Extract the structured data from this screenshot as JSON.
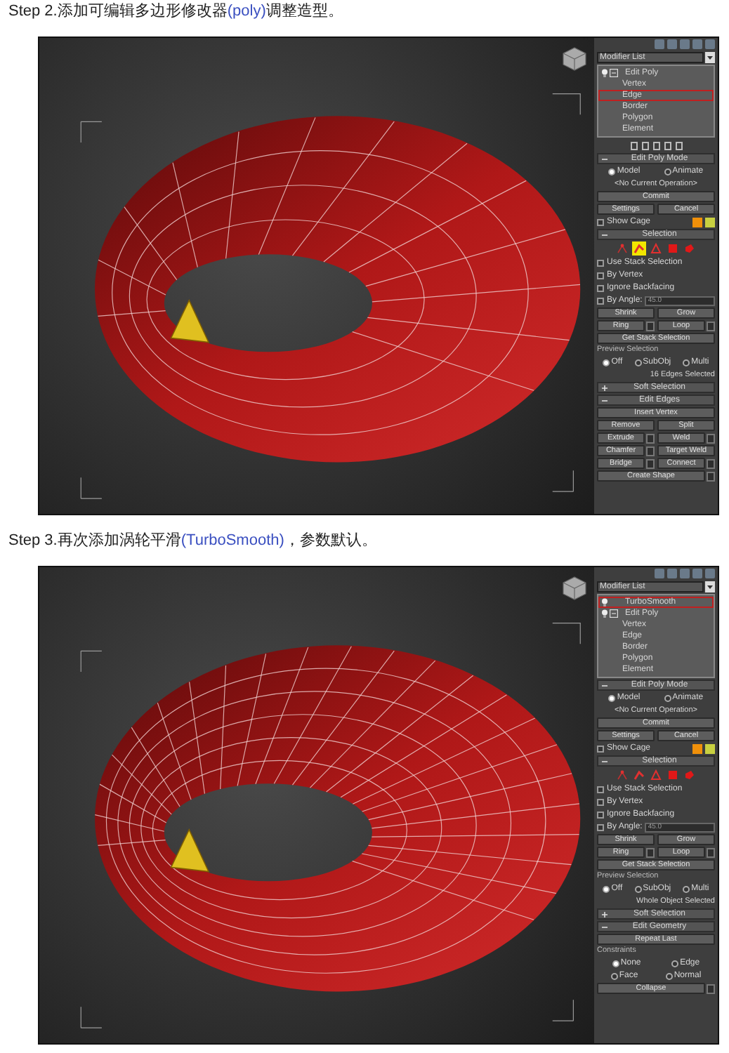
{
  "steps": [
    {
      "heading": {
        "prefix": "Step 2.添加可编辑多边形修改器",
        "highlight": "(poly)",
        "suffix": "调整造型。"
      },
      "modifier_list": "Modifier List",
      "stack": [
        {
          "label": "Edit Poly",
          "kind": "modifier",
          "expanded": true,
          "selected": false
        },
        {
          "label": "Vertex",
          "kind": "sub",
          "selected": false
        },
        {
          "label": "Edge",
          "kind": "sub",
          "selected": true
        },
        {
          "label": "Border",
          "kind": "sub",
          "selected": false
        },
        {
          "label": "Polygon",
          "kind": "sub",
          "selected": false
        },
        {
          "label": "Element",
          "kind": "sub",
          "selected": false
        }
      ],
      "stack_toolbar": true,
      "rollouts": [
        {
          "title": "Edit Poly Mode",
          "expanded": true,
          "rows": [
            {
              "kind": "radios",
              "options": [
                {
                  "label": "Model",
                  "selected": true
                },
                {
                  "label": "Animate",
                  "selected": false
                }
              ]
            },
            {
              "kind": "text",
              "text": "<No Current Operation>"
            },
            {
              "kind": "button",
              "label": "Commit"
            },
            {
              "kind": "buttons",
              "buttons": [
                {
                  "label": "Settings"
                },
                {
                  "label": "Cancel"
                }
              ]
            },
            {
              "kind": "check_swatches",
              "label": "Show Cage",
              "checked": false,
              "swatches": [
                {
                  "color": "#f0900a"
                },
                {
                  "color": "#c8d040"
                }
              ]
            }
          ]
        },
        {
          "title": "Selection",
          "expanded": true,
          "rows": [
            {
              "kind": "icons",
              "icons": [
                {
                  "kind": "vertex",
                  "selected": false
                },
                {
                  "kind": "edge",
                  "selected": true
                },
                {
                  "kind": "border",
                  "selected": false
                },
                {
                  "kind": "polygon",
                  "selected": false
                },
                {
                  "kind": "element",
                  "selected": false
                }
              ]
            },
            {
              "kind": "check",
              "label": "Use Stack Selection",
              "checked": false
            },
            {
              "kind": "check",
              "label": "By Vertex",
              "checked": false
            },
            {
              "kind": "check",
              "label": "Ignore Backfacing",
              "checked": false
            },
            {
              "kind": "angle",
              "label": "By Angle:",
              "checked": false,
              "value": "45.0"
            },
            {
              "kind": "buttons",
              "buttons": [
                {
                  "label": "Shrink"
                },
                {
                  "label": "Grow"
                }
              ]
            },
            {
              "kind": "buttons",
              "buttons": [
                {
                  "label": "Ring",
                  "settings": true
                },
                {
                  "label": "Loop",
                  "settings": true
                }
              ]
            },
            {
              "kind": "button",
              "label": "Get Stack Selection"
            },
            {
              "kind": "legend",
              "text": "Preview Selection"
            },
            {
              "kind": "radios",
              "options": [
                {
                  "label": "Off",
                  "selected": true
                },
                {
                  "label": "SubObj",
                  "selected": false
                },
                {
                  "label": "Multi",
                  "selected": false
                }
              ]
            },
            {
              "kind": "status",
              "text": "16 Edges Selected"
            }
          ]
        },
        {
          "title": "Soft Selection",
          "expanded": false
        },
        {
          "title": "Edit Edges",
          "expanded": true,
          "rows": [
            {
              "kind": "button",
              "label": "Insert Vertex"
            },
            {
              "kind": "buttons",
              "buttons": [
                {
                  "label": "Remove"
                },
                {
                  "label": "Split"
                }
              ]
            },
            {
              "kind": "buttons",
              "buttons": [
                {
                  "label": "Extrude",
                  "settings": true
                },
                {
                  "label": "Weld",
                  "settings": true
                }
              ]
            },
            {
              "kind": "buttons",
              "buttons": [
                {
                  "label": "Chamfer",
                  "settings": true
                },
                {
                  "label": "Target Weld"
                }
              ]
            },
            {
              "kind": "buttons",
              "buttons": [
                {
                  "label": "Bridge",
                  "settings": true
                },
                {
                  "label": "Connect",
                  "settings": true
                }
              ]
            },
            {
              "kind": "button",
              "label": "Create Shape",
              "settings": true
            }
          ]
        }
      ],
      "kind": "poly"
    },
    {
      "heading": {
        "prefix": "Step 3.再次添加涡轮平滑",
        "highlight": "(TurboSmooth)",
        "suffix": "，参数默认。"
      },
      "modifier_list": "Modifier List",
      "stack": [
        {
          "label": "TurboSmooth",
          "kind": "modifier",
          "selected": true
        },
        {
          "label": "Edit Poly",
          "kind": "modifier",
          "expanded": true,
          "selected": false
        },
        {
          "label": "Vertex",
          "kind": "sub",
          "selected": false
        },
        {
          "label": "Edge",
          "kind": "sub",
          "selected": false
        },
        {
          "label": "Border",
          "kind": "sub",
          "selected": false
        },
        {
          "label": "Polygon",
          "kind": "sub",
          "selected": false
        },
        {
          "label": "Element",
          "kind": "sub",
          "selected": false
        }
      ],
      "rollouts": [
        {
          "title": "Edit Poly Mode",
          "expanded": true,
          "rows": [
            {
              "kind": "radios",
              "options": [
                {
                  "label": "Model",
                  "selected": true
                },
                {
                  "label": "Animate",
                  "selected": false
                }
              ]
            },
            {
              "kind": "text",
              "text": "<No Current Operation>"
            },
            {
              "kind": "button",
              "label": "Commit"
            },
            {
              "kind": "buttons",
              "buttons": [
                {
                  "label": "Settings"
                },
                {
                  "label": "Cancel"
                }
              ]
            },
            {
              "kind": "check_swatches",
              "label": "Show Cage",
              "checked": false,
              "swatches": [
                {
                  "color": "#f0900a"
                },
                {
                  "color": "#c8d040"
                }
              ]
            }
          ]
        },
        {
          "title": "Selection",
          "expanded": true,
          "rows": [
            {
              "kind": "icons",
              "icons": [
                {
                  "kind": "vertex",
                  "selected": false
                },
                {
                  "kind": "edge",
                  "selected": false
                },
                {
                  "kind": "border",
                  "selected": false
                },
                {
                  "kind": "polygon",
                  "selected": false
                },
                {
                  "kind": "element",
                  "selected": false
                }
              ]
            },
            {
              "kind": "check",
              "label": "Use Stack Selection",
              "checked": false
            },
            {
              "kind": "check",
              "label": "By Vertex",
              "checked": false
            },
            {
              "kind": "check",
              "label": "Ignore Backfacing",
              "checked": false
            },
            {
              "kind": "angle",
              "label": "By Angle:",
              "checked": false,
              "value": "45.0"
            },
            {
              "kind": "buttons",
              "buttons": [
                {
                  "label": "Shrink"
                },
                {
                  "label": "Grow"
                }
              ]
            },
            {
              "kind": "buttons",
              "buttons": [
                {
                  "label": "Ring",
                  "settings": true
                },
                {
                  "label": "Loop",
                  "settings": true
                }
              ]
            },
            {
              "kind": "button",
              "label": "Get Stack Selection"
            },
            {
              "kind": "legend",
              "text": "Preview Selection"
            },
            {
              "kind": "radios",
              "options": [
                {
                  "label": "Off",
                  "selected": true
                },
                {
                  "label": "SubObj",
                  "selected": false
                },
                {
                  "label": "Multi",
                  "selected": false
                }
              ]
            },
            {
              "kind": "status",
              "text": "Whole Object Selected"
            }
          ]
        },
        {
          "title": "Soft Selection",
          "expanded": false
        },
        {
          "title": "Edit Geometry",
          "expanded": true,
          "rows": [
            {
              "kind": "button",
              "label": "Repeat Last"
            },
            {
              "kind": "legend",
              "text": "Constraints"
            },
            {
              "kind": "radios",
              "options": [
                {
                  "label": "None",
                  "selected": true
                },
                {
                  "label": "Edge",
                  "selected": false
                }
              ]
            },
            {
              "kind": "radios",
              "options": [
                {
                  "label": "Face",
                  "selected": false
                },
                {
                  "label": "Normal",
                  "selected": false
                }
              ]
            },
            {
              "kind": "button",
              "label": "Collapse",
              "settings": true
            }
          ]
        }
      ],
      "kind": "smooth"
    }
  ]
}
